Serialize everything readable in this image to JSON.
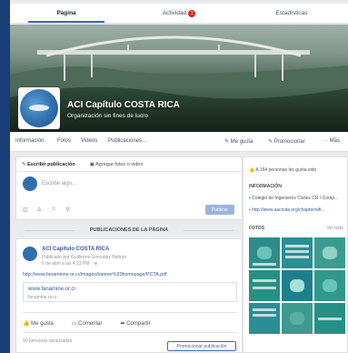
{
  "tabs": [
    {
      "label": "Página",
      "active": true
    },
    {
      "label": "Actividad",
      "badge": "1"
    },
    {
      "label": "Estadísticas"
    }
  ],
  "page": {
    "title": "ACI Capítulo COSTA RICA",
    "subtitle": "Organización sin fines de lucro"
  },
  "page_nav": {
    "items": [
      "Información",
      "Fotos",
      "Videos",
      "Publicaciones..."
    ],
    "actions": [
      "Me gusta",
      "Promocionar",
      "Más"
    ]
  },
  "composer": {
    "tabs": [
      "Escribir publicación",
      "Agregar fotos o video"
    ],
    "placeholder": "Escribe algo...",
    "publish_label": "Publicar"
  },
  "feed": {
    "section_title": "PUBLICACIONES DE LA PÁGINA",
    "post": {
      "author": "ACI Capítulo COSTA RICA",
      "meta1": "Publicado por Guillermo González Beltrán",
      "meta2": "6 de abril a las 4:23 PM · ",
      "link": "http://www.fanaminne.or.cr/images/banner%20homepage/PCTA.pdf",
      "card_title": "www.fanamine.or.cr",
      "card_sub": "fanamine.or.cr",
      "actions": [
        "Me gusta",
        "Comentar",
        "Compartir"
      ],
      "footer": "90 personas alcanzadas",
      "promote_label": "Promocionar publicación"
    }
  },
  "sidebar": {
    "likes": "A 164 personas les gusta esto",
    "info_header": "INFORMACIÓN",
    "info_line1": "Colegio de Ingenieros Civiles CR / Comp...",
    "info_line2": "http://www.aacoste.org/chapter/wfi...",
    "photos_header": "FOTOS",
    "see_all": "Ver todo"
  },
  "colors": {
    "accent": "#4267b2",
    "background": "#1b3d78"
  }
}
